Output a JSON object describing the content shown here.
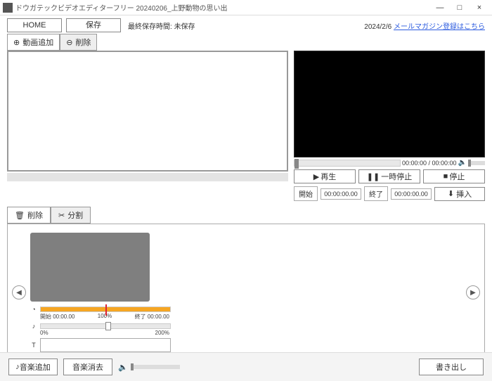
{
  "window": {
    "title": "ドウガテックビデオエディターフリー 20240206_上野動物の思い出",
    "min": "—",
    "max": "□",
    "close": "×"
  },
  "header": {
    "home": "HOME",
    "save": "保存",
    "lastsave_label": "最終保存時間:",
    "lastsave_value": "未保存",
    "date": "2024/2/6",
    "maglink": "メールマガジン登録はこちら"
  },
  "tabs": {
    "add_video": "動画追加",
    "delete": "削除"
  },
  "preview": {
    "time": "00:00:00 / 00:00:00",
    "play": "再生",
    "pause": "一時停止",
    "stop": "停止",
    "start_label": "開始",
    "start_tc": "00:00:00.00",
    "end_label": "終了",
    "end_tc": "00:00:00.00",
    "insert": "挿入"
  },
  "editor": {
    "tab_delete": "削除",
    "tab_split": "分割",
    "clip": {
      "start_label": "開始",
      "start_tc": "00:00.00",
      "mid_pct": "100%",
      "end_label": "終了",
      "end_tc": "00:00.00",
      "scale0": "0%",
      "scale200": "200%"
    }
  },
  "footer": {
    "music_add": "音楽追加",
    "music_remove": "音楽消去",
    "export": "書き出し"
  },
  "icons": {
    "play": "▶",
    "pause": "❚❚",
    "stop": "■",
    "speaker": "🔈",
    "note": "♪",
    "clock": "◔",
    "text": "T",
    "trash": "🗑",
    "scissors": "✂",
    "plus": "⊕",
    "minus": "⊖",
    "left": "◀",
    "right": "▶",
    "download": "⬇"
  }
}
